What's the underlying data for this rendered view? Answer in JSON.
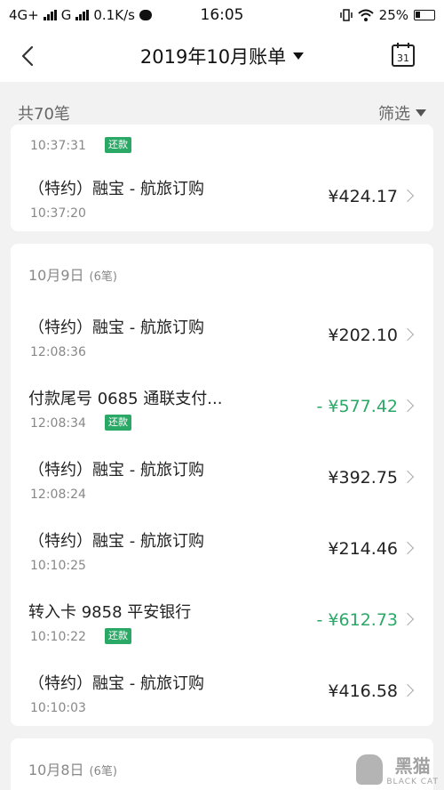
{
  "status_bar": {
    "network_1": "4G+",
    "network_2": "G",
    "speed": "0.1K/s",
    "time": "16:05",
    "battery": "25%"
  },
  "nav": {
    "title": "2019年10月账单",
    "calendar_day": "31"
  },
  "summary": {
    "count_label": "共70笔",
    "filter_label": "筛选"
  },
  "partial_row": {
    "time": "10:37:31",
    "tag": "还款"
  },
  "card1_rows": [
    {
      "title": "（特约）融宝 - 航旅订购",
      "time": "10:37:20",
      "amount": "¥424.17"
    }
  ],
  "group_oct9": {
    "date": "10月9日",
    "count": "(6笔)",
    "rows": [
      {
        "title": "（特约）融宝 - 航旅订购",
        "time": "12:08:36",
        "amount": "¥202.10"
      },
      {
        "title": "付款尾号 0685 通联支付...",
        "time": "12:08:34",
        "tag": "还款",
        "amount": "- ¥577.42"
      },
      {
        "title": "（特约）融宝 - 航旅订购",
        "time": "12:08:24",
        "amount": "¥392.75"
      },
      {
        "title": "（特约）融宝 - 航旅订购",
        "time": "10:10:25",
        "amount": "¥214.46"
      },
      {
        "title": "转入卡 9858  平安银行",
        "time": "10:10:22",
        "tag": "还款",
        "amount": "- ¥612.73"
      },
      {
        "title": "（特约）融宝 - 航旅订购",
        "time": "10:10:03",
        "amount": "¥416.58"
      }
    ]
  },
  "group_oct8": {
    "date": "10月8日",
    "count": "(6笔)"
  },
  "watermark": {
    "cn": "黑猫",
    "en": "BLACK CAT"
  },
  "colors": {
    "accent_green": "#2aa866",
    "background": "#f2f2f2"
  }
}
